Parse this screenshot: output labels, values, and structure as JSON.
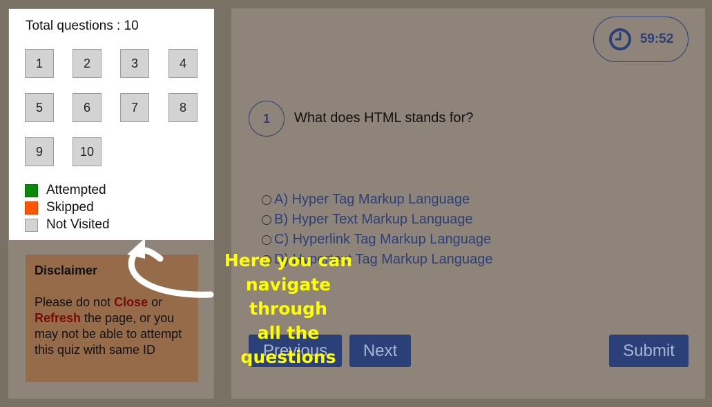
{
  "sidebar": {
    "total_label": "Total questions : 10",
    "questions": [
      "1",
      "2",
      "3",
      "4",
      "5",
      "6",
      "7",
      "8",
      "9",
      "10"
    ],
    "legend": [
      {
        "label": "Attempted",
        "color": "#0a8a0a"
      },
      {
        "label": "Skipped",
        "color": "#ff5500"
      },
      {
        "label": "Not Visited",
        "color": "#d3d3d3"
      }
    ]
  },
  "disclaimer": {
    "title": "Disclaimer",
    "text_1": "Please do not ",
    "close_word": "Close",
    "text_2": " or ",
    "refresh_word": "Refresh",
    "text_3": " the page, or you may not be able to attempt this quiz with same ID"
  },
  "timer": {
    "value": "59:52",
    "icon": "clock-icon"
  },
  "question": {
    "number": "1",
    "text": "What does HTML stands for?",
    "options": [
      "A) Hyper Tag Markup Language",
      "B) Hyper Text Markup Language",
      "C) Hyperlink Tag Markup Language",
      "D) Hypertext Tag Markup Language"
    ]
  },
  "buttons": {
    "previous": "Previous",
    "next": "Next",
    "submit": "Submit"
  },
  "annotation": {
    "lines": [
      "Here you can",
      "navigate through",
      "all the questions"
    ]
  },
  "colors": {
    "accent": "#2b3f78",
    "annotation": "#ffff00",
    "overlay": "#8e8479"
  }
}
